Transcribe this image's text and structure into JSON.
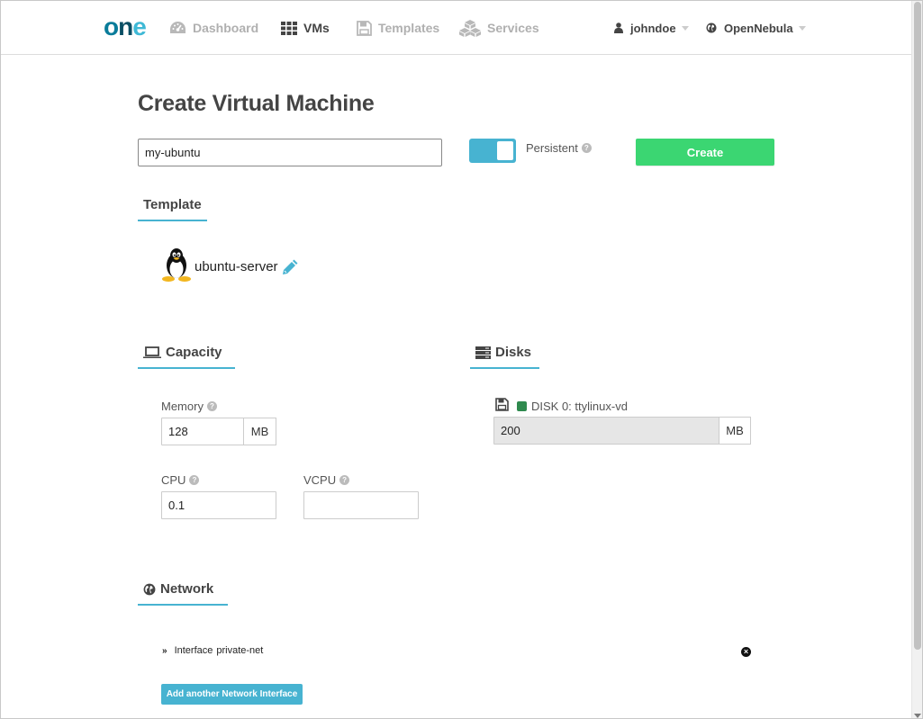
{
  "brand": {
    "logo_o": "o",
    "logo_n": "n",
    "logo_e": "e"
  },
  "nav": {
    "dashboard": "Dashboard",
    "vms": "VMs",
    "templates": "Templates",
    "services": "Services"
  },
  "user_menu": {
    "user": "johndoe",
    "zone": "OpenNebula"
  },
  "page": {
    "title": "Create Virtual Machine",
    "vm_name_value": "my-ubuntu",
    "persistent_label": "Persistent",
    "persistent_on": true,
    "create_label": "Create"
  },
  "template": {
    "section_title": "Template",
    "name": "ubuntu-server"
  },
  "capacity": {
    "section_title": "Capacity",
    "memory_label": "Memory",
    "memory_value": "128",
    "memory_unit": "MB",
    "cpu_label": "CPU",
    "cpu_value": "0.1",
    "vcpu_label": "VCPU",
    "vcpu_value": ""
  },
  "disks": {
    "section_title": "Disks",
    "disk_label": "DISK 0: ttylinux-vd",
    "disk_size": "200",
    "disk_unit": "MB"
  },
  "network": {
    "section_title": "Network",
    "interface_label": "Interface",
    "interface_name": "private-net",
    "add_label": "Add another Network Interface"
  },
  "colors": {
    "accent": "#47b3d1",
    "create_green": "#3bd672",
    "disk_green": "#2f8a4e"
  }
}
